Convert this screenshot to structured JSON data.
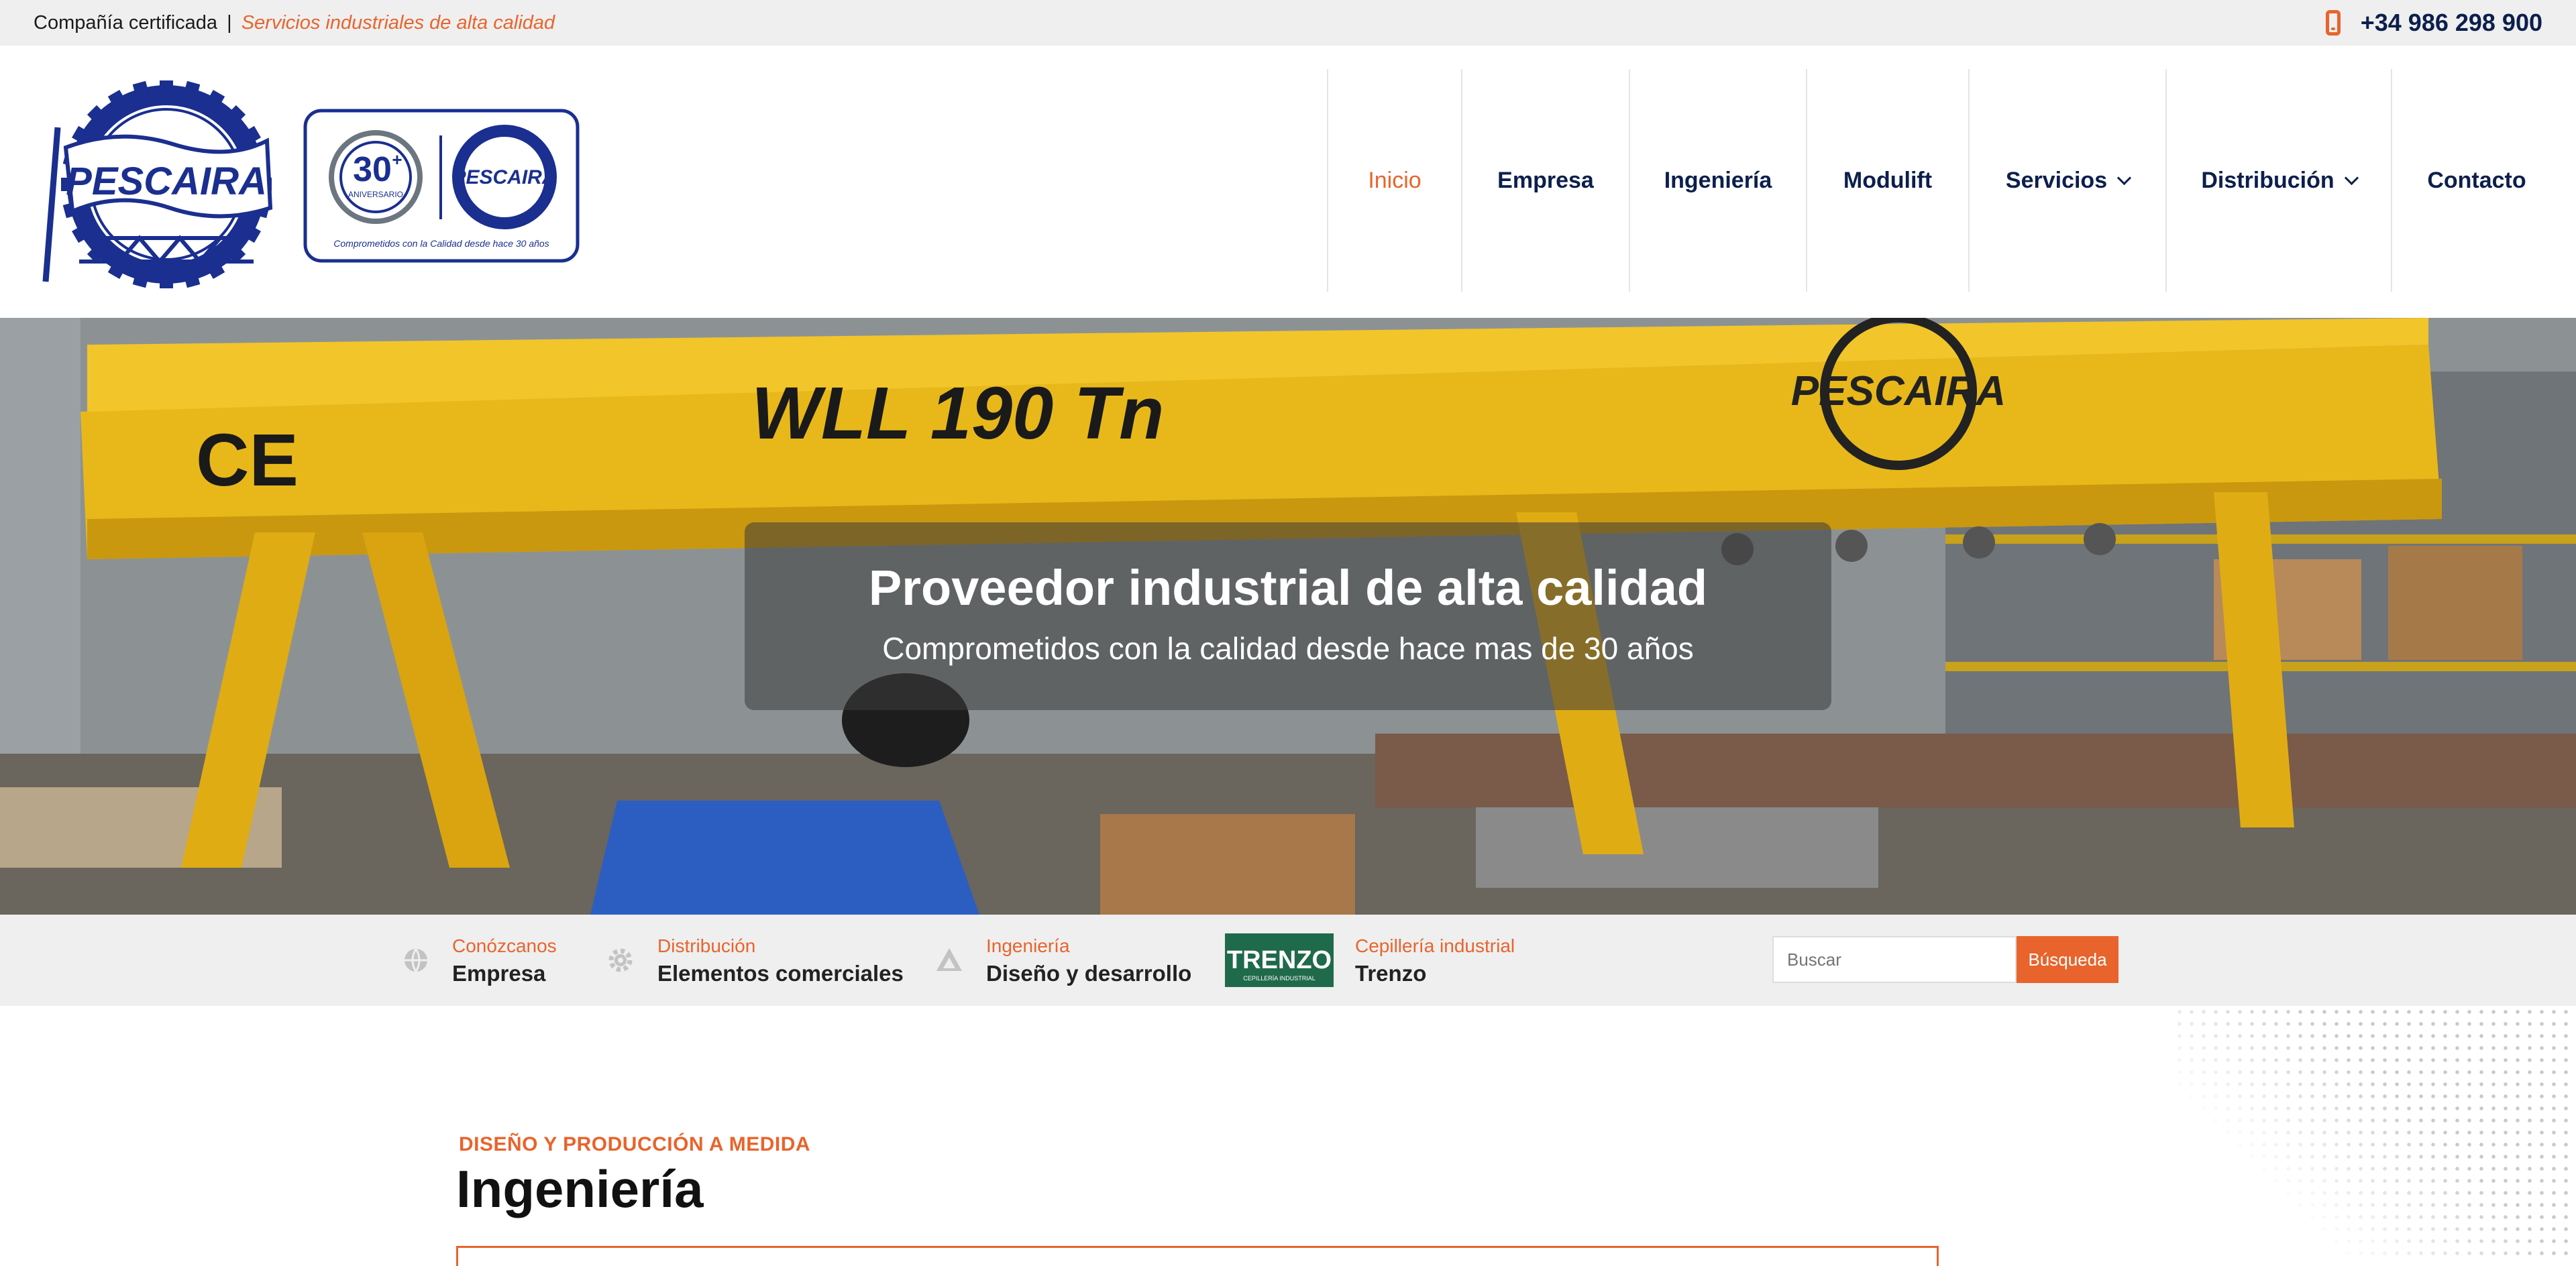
{
  "topbar": {
    "certified": "Compañía certificada",
    "separator": "|",
    "tagline": "Servicios industriales de alta calidad",
    "phone": "+34 986 298 900"
  },
  "logos": {
    "main_text": "PESCAIRA",
    "anniversary_number": "30",
    "anniversary_plus": "+",
    "anniversary_word": "ANIVERSARIO",
    "anniversary_caption": "Comprometidos con la Calidad desde hace 30 años"
  },
  "nav": {
    "items": [
      {
        "label": "Inicio",
        "active": true,
        "dropdown": false
      },
      {
        "label": "Empresa",
        "active": false,
        "dropdown": false
      },
      {
        "label": "Ingeniería",
        "active": false,
        "dropdown": false
      },
      {
        "label": "Modulift",
        "active": false,
        "dropdown": false
      },
      {
        "label": "Servicios",
        "active": false,
        "dropdown": true
      },
      {
        "label": "Distribución",
        "active": false,
        "dropdown": true
      },
      {
        "label": "Contacto",
        "active": false,
        "dropdown": false
      }
    ]
  },
  "hero": {
    "title": "Proveedor industrial de alta calidad",
    "subtitle": "Comprometidos con la calidad desde hace mas de 30 años",
    "beam_text": "WLL 190 Tn",
    "ce_mark": "CE"
  },
  "infobar": {
    "items": [
      {
        "small": "Conózcanos",
        "big": "Empresa",
        "icon": "globe-icon"
      },
      {
        "small": "Distribución",
        "big": "Elementos comerciales",
        "icon": "gear-icon"
      },
      {
        "small": "Ingeniería",
        "big": "Diseño y desarrollo",
        "icon": "triangle-icon"
      },
      {
        "small": "Cepillería industrial",
        "big": "Trenzo",
        "icon": "trenzo-logo"
      }
    ],
    "trenzo_logo_text": "TRENZO",
    "trenzo_logo_sub": "CEPILLERÍA INDUSTRIAL",
    "search_placeholder": "Buscar",
    "search_button": "Búsqueda"
  },
  "section": {
    "kicker": "DISEÑO Y PRODUCCIÓN A MEDIDA",
    "title": "Ingeniería"
  },
  "colors": {
    "accent": "#e8642c",
    "navy": "#0c1f4d",
    "logo_blue": "#1a2f8f",
    "topbar_bg": "#efefef"
  }
}
